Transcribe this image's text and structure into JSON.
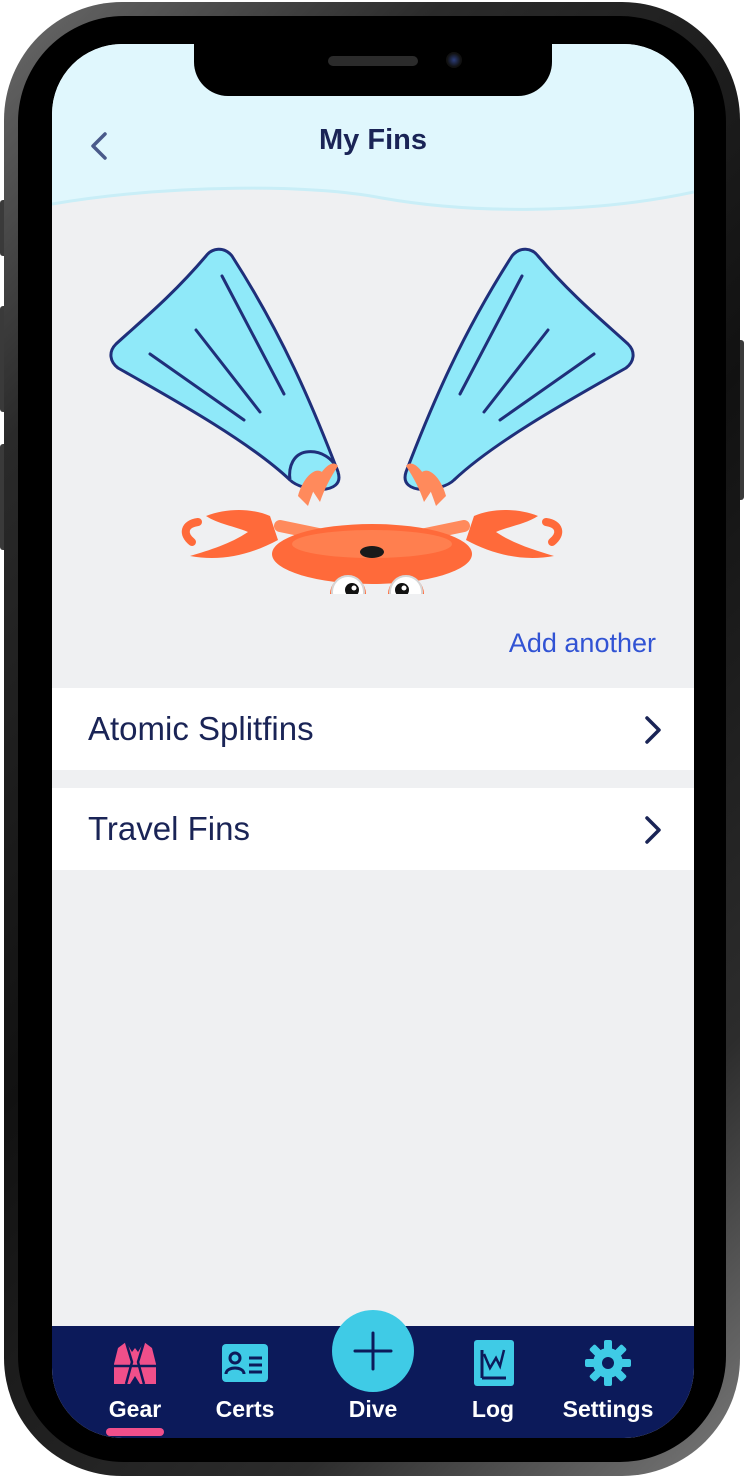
{
  "header": {
    "title": "My Fins",
    "back_icon": "chevron-left-icon"
  },
  "illustration": {
    "subject": "crab-with-fins-illustration"
  },
  "actions": {
    "add_another_label": "Add another"
  },
  "fins": [
    {
      "label": "Atomic Splitfins"
    },
    {
      "label": "Travel Fins"
    }
  ],
  "tabbar": {
    "tabs": [
      {
        "label": "Gear",
        "icon": "vest-icon",
        "active": true
      },
      {
        "label": "Certs",
        "icon": "id-card-icon",
        "active": false
      },
      {
        "label": "Dive",
        "icon": "plus-icon",
        "active": false
      },
      {
        "label": "Log",
        "icon": "chart-icon",
        "active": false
      },
      {
        "label": "Settings",
        "icon": "gear-icon",
        "active": false
      }
    ]
  },
  "colors": {
    "header_bg": "#e0f7fd",
    "title": "#1a2456",
    "link": "#3153d4",
    "tabbar_bg": "#0c1a5a",
    "accent_cyan": "#3fcbe6",
    "active_pink": "#f04f8a",
    "screen_bg": "#eff0f2"
  }
}
